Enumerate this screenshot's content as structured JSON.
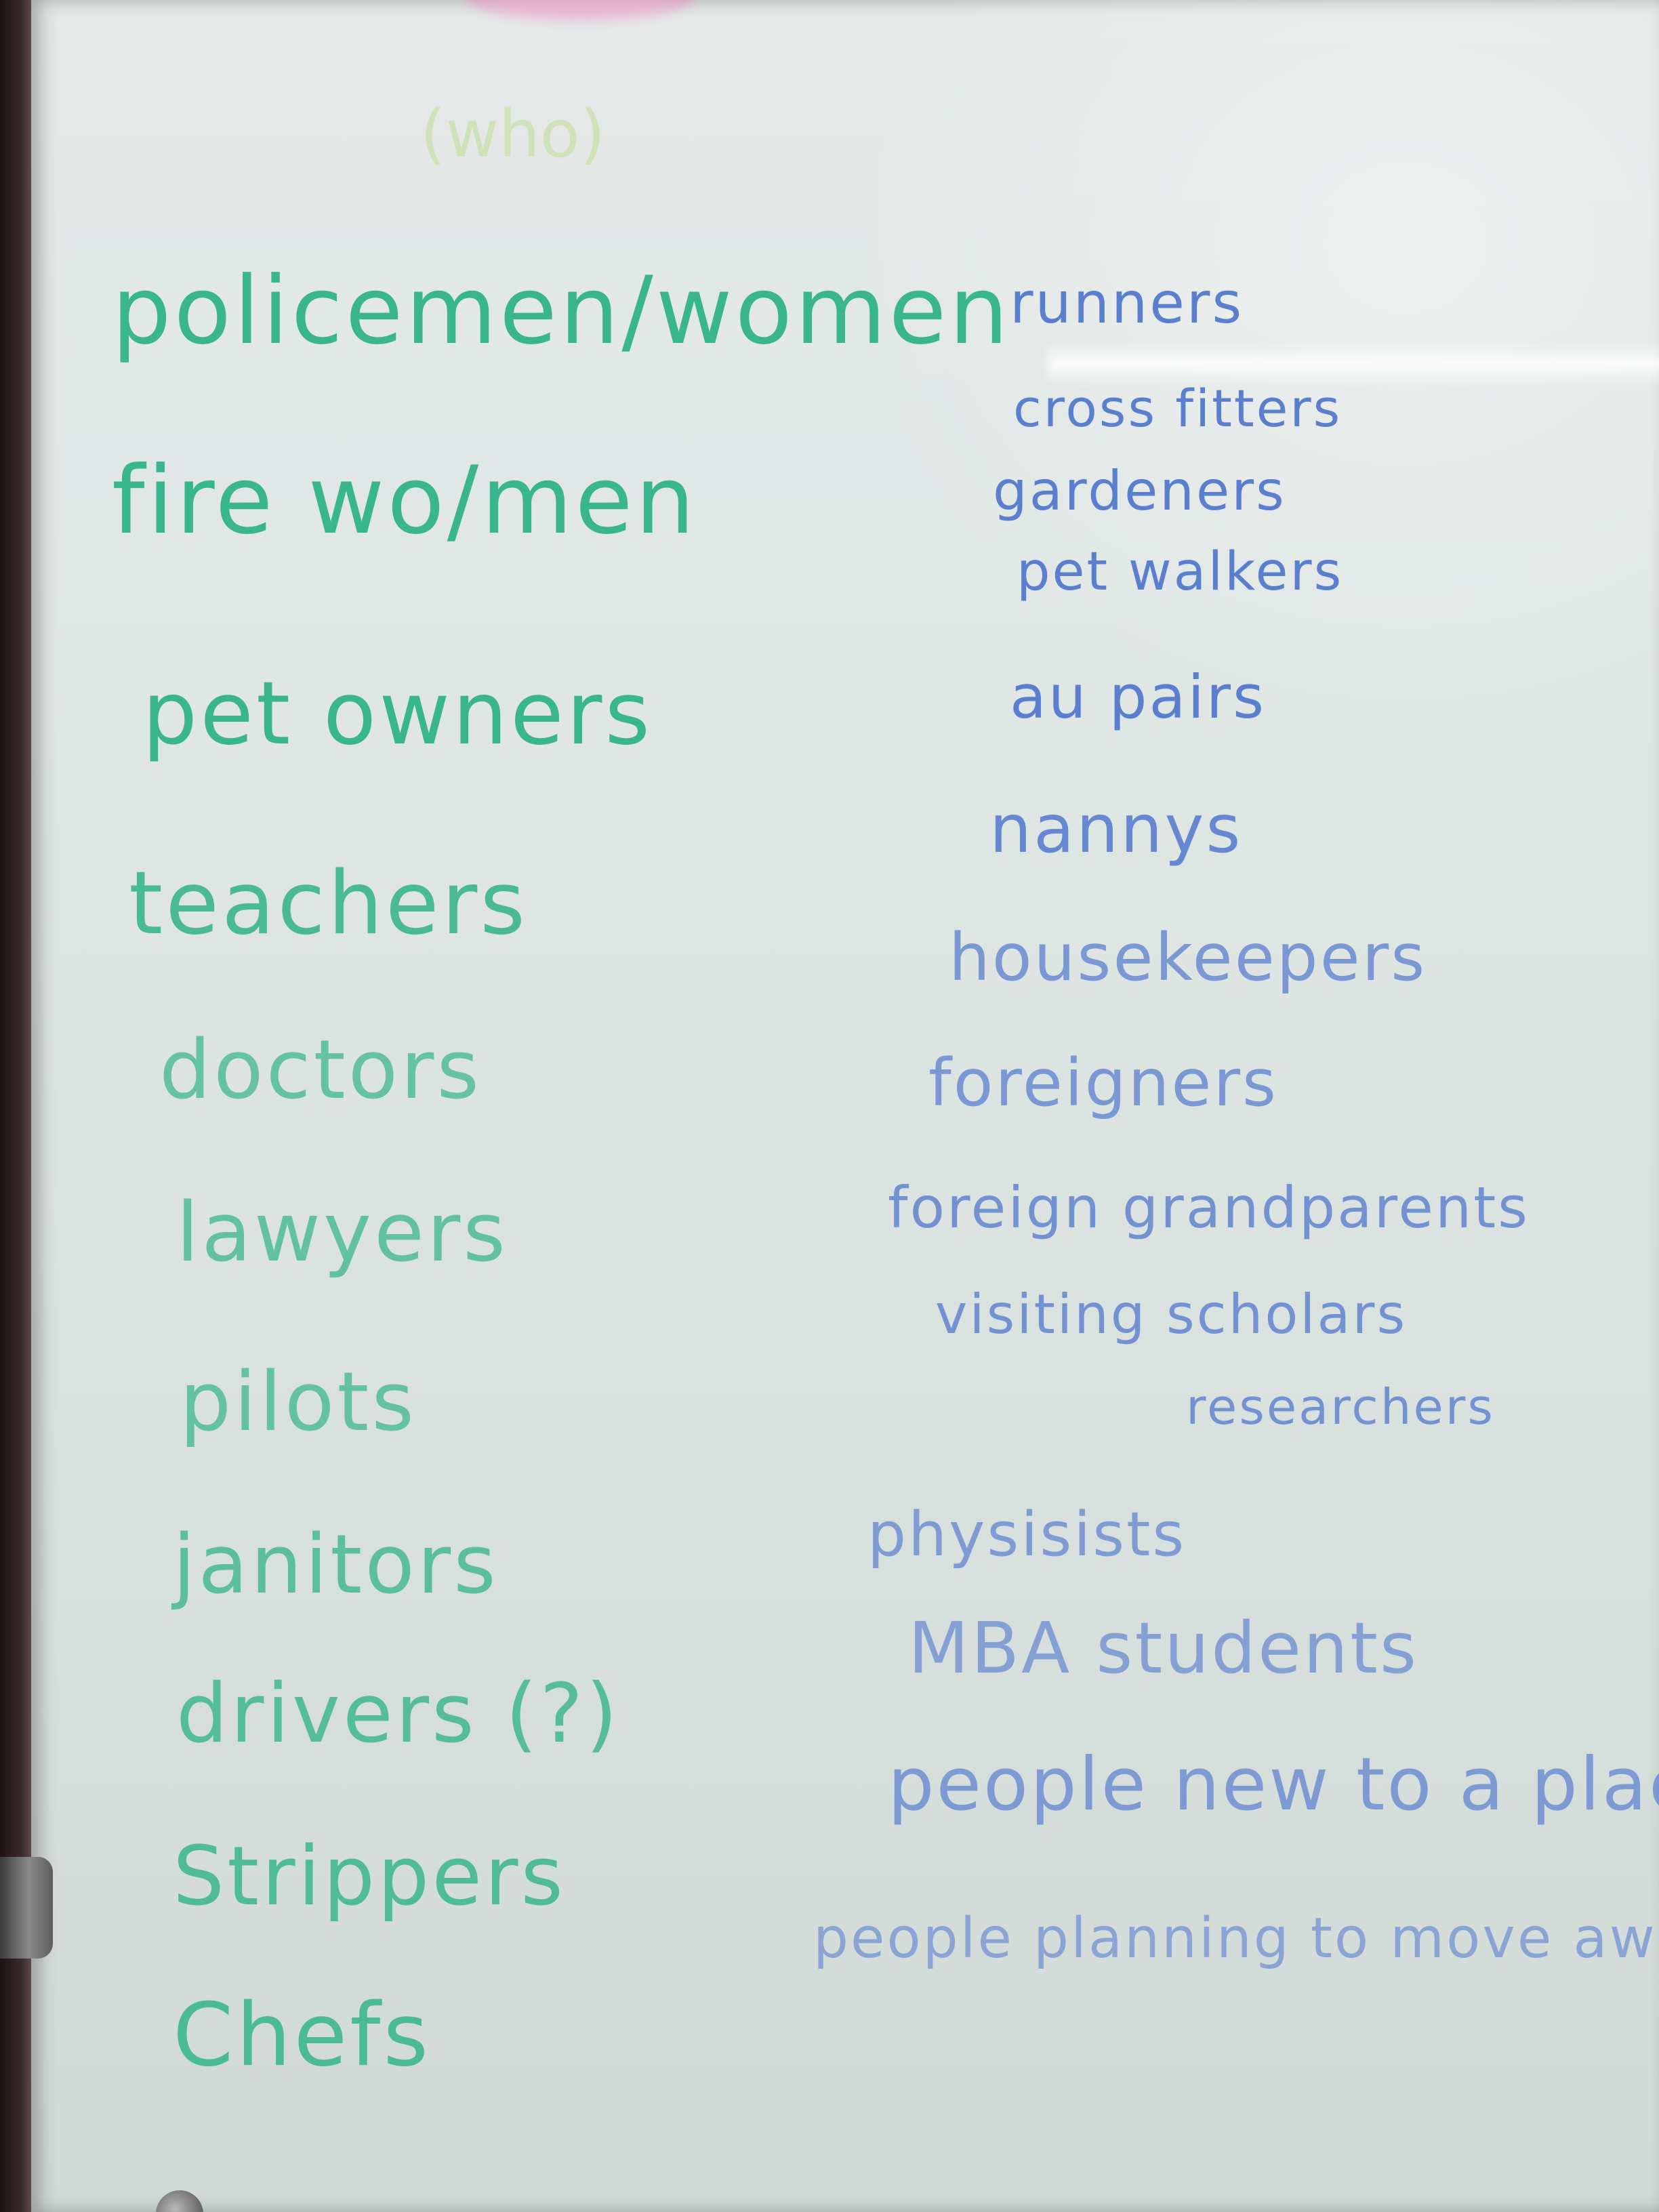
{
  "board": {
    "header": "(who)",
    "left_column": [
      "policemen/women",
      "fire wo/men",
      "pet owners",
      "teachers",
      "doctors",
      "lawyers",
      "pilots",
      "janitors",
      "drivers (?)",
      "Strippers",
      "Chefs"
    ],
    "right_column": [
      "runners",
      "cross fitters",
      "gardeners",
      "pet walkers",
      "au pairs",
      "nannys",
      "housekeepers",
      "foreigners",
      "foreign grandparents",
      "visiting scholars",
      "researchers",
      "physisists",
      "MBA students",
      "people new to a place",
      "people planning to move away"
    ]
  },
  "colors": {
    "left_ink": "#39b68d",
    "right_ink": "#5a7fcf",
    "header_ink": "#cfe3b8",
    "board": "#dfe6e4"
  }
}
